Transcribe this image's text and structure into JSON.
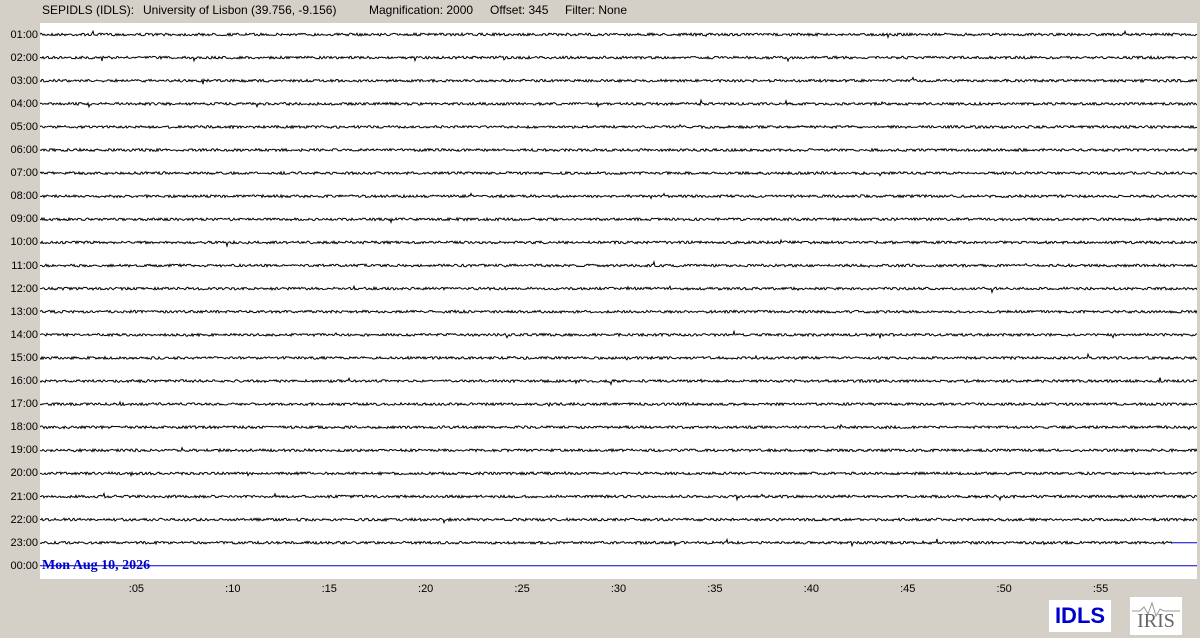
{
  "header": {
    "station": "SEPIDLS (IDLS):",
    "location": "University of Lisbon (39.756, -9.156)",
    "magnification": "Magnification: 2000",
    "offset": "Offset: 345",
    "filter": "Filter: None"
  },
  "rows": [
    "01:00",
    "02:00",
    "03:00",
    "04:00",
    "05:00",
    "06:00",
    "07:00",
    "08:00",
    "09:00",
    "10:00",
    "11:00",
    "12:00",
    "13:00",
    "14:00",
    "15:00",
    "16:00",
    "17:00",
    "18:00",
    "19:00",
    "20:00",
    "21:00",
    "22:00",
    "23:00",
    "00:00"
  ],
  "date_label": "Mon Aug 10, 2026",
  "x_axis_labels": [
    ":05",
    ":10",
    ":15",
    ":20",
    ":25",
    ":30",
    ":35",
    ":40",
    ":45",
    ":50",
    ":55"
  ],
  "logos": {
    "left": "IDLS",
    "right": "IRIS"
  },
  "colors": {
    "background": "#d4d0c8",
    "plot_background": "#ffffff",
    "trace": "#000000",
    "current_trace": "#0000cc",
    "date_text": "#0000cc"
  }
}
